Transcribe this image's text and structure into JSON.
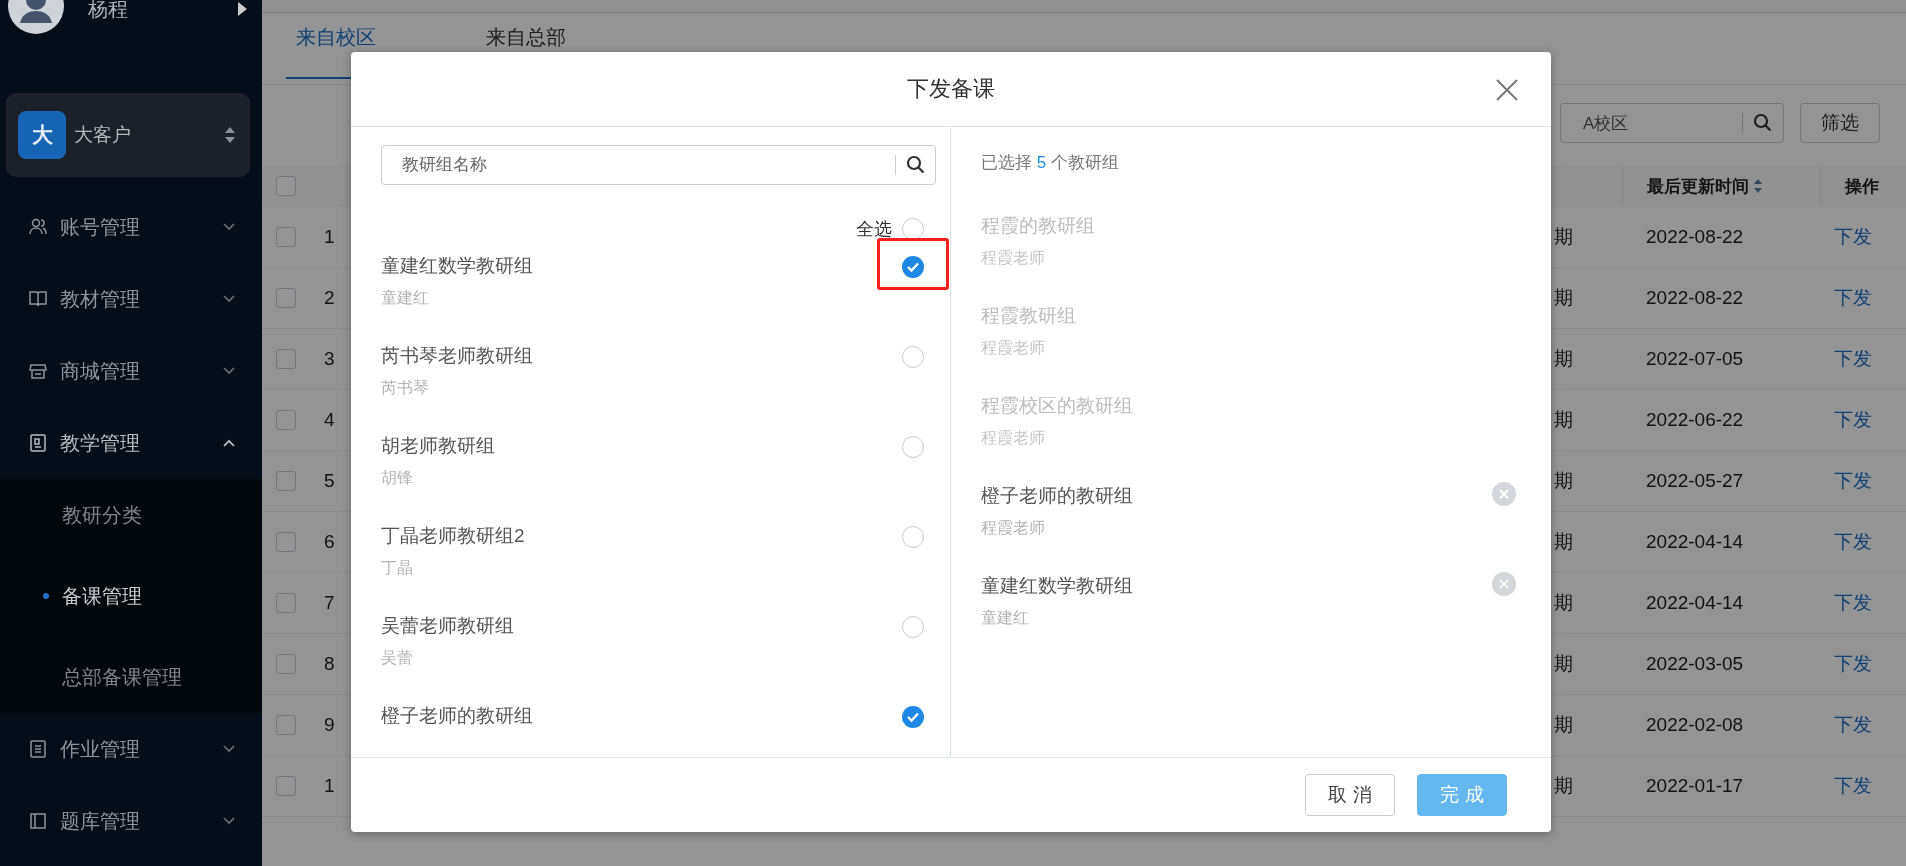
{
  "sidebar": {
    "user": {
      "name": "杨程"
    },
    "client": {
      "badge": "大",
      "name": "大客户"
    },
    "menu": [
      {
        "label": "账号管理",
        "expanded": false
      },
      {
        "label": "教材管理",
        "expanded": false
      },
      {
        "label": "商城管理",
        "expanded": false
      },
      {
        "label": "教学管理",
        "expanded": true,
        "children": [
          {
            "label": "教研分类",
            "selected": false
          },
          {
            "label": "备课管理",
            "selected": true
          },
          {
            "label": "总部备课管理",
            "selected": false
          }
        ]
      },
      {
        "label": "作业管理",
        "expanded": false
      },
      {
        "label": "题库管理",
        "expanded": false
      }
    ]
  },
  "main": {
    "tabs": [
      {
        "label": "来自校区",
        "selected": true
      },
      {
        "label": "来自总部",
        "selected": false
      }
    ],
    "filter": {
      "value": "A校区"
    },
    "filter_button": "筛选",
    "table": {
      "header_checked": false,
      "columns": [
        {
          "label": "最后更新时间",
          "sortable": true
        },
        {
          "label": "操作",
          "sortable": false
        }
      ],
      "rows": [
        {
          "checked": false,
          "number": "1",
          "column_3": "期",
          "updated": "2022-08-22",
          "action": "下发"
        },
        {
          "checked": false,
          "number": "2",
          "column_3": "期",
          "updated": "2022-08-22",
          "action": "下发"
        },
        {
          "checked": false,
          "number": "3",
          "column_3": "期",
          "updated": "2022-07-05",
          "action": "下发"
        },
        {
          "checked": false,
          "number": "4",
          "column_3": "期",
          "updated": "2022-06-22",
          "action": "下发"
        },
        {
          "checked": false,
          "number": "5",
          "column_3": "期",
          "updated": "2022-05-27",
          "action": "下发"
        },
        {
          "checked": false,
          "number": "6",
          "column_3": "期",
          "updated": "2022-04-14",
          "action": "下发"
        },
        {
          "checked": false,
          "number": "7",
          "column_3": "期",
          "updated": "2022-04-14",
          "action": "下发"
        },
        {
          "checked": false,
          "number": "8",
          "column_3": "期",
          "updated": "2022-03-05",
          "action": "下发"
        },
        {
          "checked": false,
          "number": "9",
          "column_3": "期",
          "updated": "2022-02-08",
          "action": "下发"
        },
        {
          "checked": false,
          "number": "1",
          "column_3": "期",
          "updated": "2022-01-17",
          "action": "下发"
        }
      ]
    }
  },
  "dialog": {
    "title": "下发备课",
    "search": {
      "placeholder": "教研组名称"
    },
    "select_all": {
      "label": "全选",
      "checked": false
    },
    "groups": [
      {
        "name": "童建红数学教研组",
        "teacher": "童建红",
        "checked": true,
        "highlighted": true
      },
      {
        "name": "芮书琴老师教研组",
        "teacher": "芮书琴",
        "checked": false
      },
      {
        "name": "胡老师教研组",
        "teacher": "胡锋",
        "checked": false
      },
      {
        "name": "丁晶老师教研组2",
        "teacher": "丁晶",
        "checked": false
      },
      {
        "name": "吴蕾老师教研组",
        "teacher": "吴蕾",
        "checked": false
      },
      {
        "name": "橙子老师的教研组",
        "checked": true
      }
    ],
    "summary": {
      "prefix": "已选择",
      "count": "5",
      "suffix": "个教研组"
    },
    "selected": [
      {
        "name": "程霞的教研组",
        "teacher": "程霞老师",
        "disabled": true
      },
      {
        "name": "程霞教研组",
        "teacher": "程霞老师",
        "disabled": true
      },
      {
        "name": "程霞校区的教研组",
        "teacher": "程霞老师",
        "disabled": true
      },
      {
        "name": "橙子老师的教研组",
        "teacher": "程霞老师",
        "disabled": false
      },
      {
        "name": "童建红数学教研组",
        "teacher": "童建红",
        "disabled": false
      }
    ],
    "cancel_button": "取 消",
    "confirm_button": "完 成"
  }
}
